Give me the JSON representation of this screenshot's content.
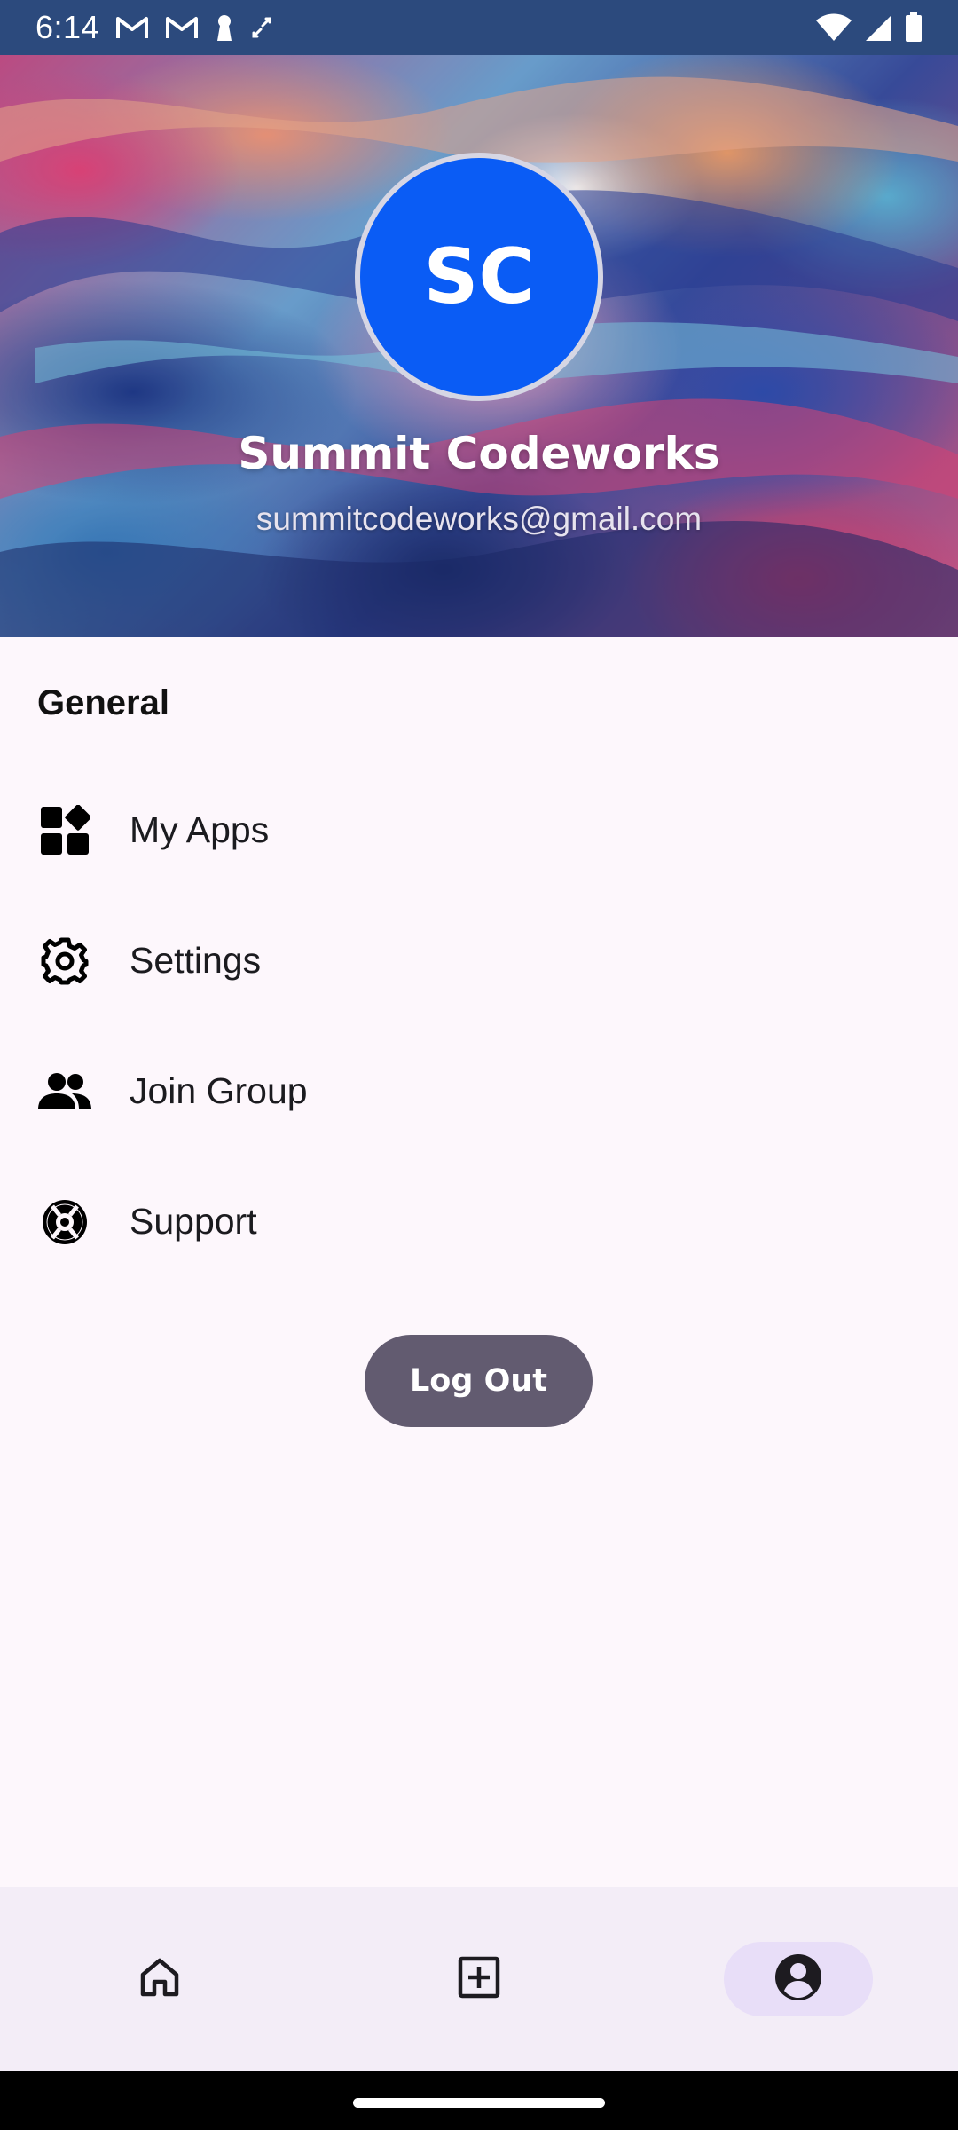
{
  "status_bar": {
    "time": "6:14",
    "left_icons": [
      "gmail-icon",
      "gmail-icon",
      "keyhole-icon",
      "sync-icon"
    ],
    "right_icons": [
      "wifi-icon",
      "signal-icon",
      "battery-icon"
    ]
  },
  "profile": {
    "initials": "SC",
    "avatar_color": "#0a5cf5",
    "name": "Summit Codeworks",
    "email": "summitcodeworks@gmail.com"
  },
  "general": {
    "title": "General",
    "items": [
      {
        "label": "My Apps",
        "icon": "apps-grid-icon"
      },
      {
        "label": "Settings",
        "icon": "gear-icon"
      },
      {
        "label": "Join Group",
        "icon": "group-icon"
      },
      {
        "label": "Support",
        "icon": "lifebuoy-icon"
      }
    ]
  },
  "logout": {
    "label": "Log Out",
    "color": "#625b70"
  },
  "bottom_nav": {
    "items": [
      {
        "name": "home",
        "icon": "home-icon",
        "active": false
      },
      {
        "name": "add",
        "icon": "add-box-icon",
        "active": false
      },
      {
        "name": "profile",
        "icon": "account-circle-icon",
        "active": true
      }
    ],
    "active_color": "#e8def8"
  }
}
